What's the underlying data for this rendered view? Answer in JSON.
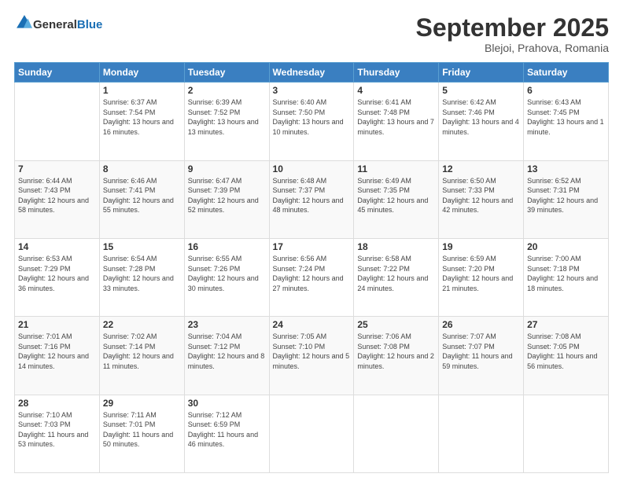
{
  "header": {
    "logo_general": "General",
    "logo_blue": "Blue",
    "title": "September 2025",
    "location": "Blejoi, Prahova, Romania"
  },
  "weekdays": [
    "Sunday",
    "Monday",
    "Tuesday",
    "Wednesday",
    "Thursday",
    "Friday",
    "Saturday"
  ],
  "weeks": [
    [
      {
        "day": "",
        "sunrise": "",
        "sunset": "",
        "daylight": ""
      },
      {
        "day": "1",
        "sunrise": "Sunrise: 6:37 AM",
        "sunset": "Sunset: 7:54 PM",
        "daylight": "Daylight: 13 hours and 16 minutes."
      },
      {
        "day": "2",
        "sunrise": "Sunrise: 6:39 AM",
        "sunset": "Sunset: 7:52 PM",
        "daylight": "Daylight: 13 hours and 13 minutes."
      },
      {
        "day": "3",
        "sunrise": "Sunrise: 6:40 AM",
        "sunset": "Sunset: 7:50 PM",
        "daylight": "Daylight: 13 hours and 10 minutes."
      },
      {
        "day": "4",
        "sunrise": "Sunrise: 6:41 AM",
        "sunset": "Sunset: 7:48 PM",
        "daylight": "Daylight: 13 hours and 7 minutes."
      },
      {
        "day": "5",
        "sunrise": "Sunrise: 6:42 AM",
        "sunset": "Sunset: 7:46 PM",
        "daylight": "Daylight: 13 hours and 4 minutes."
      },
      {
        "day": "6",
        "sunrise": "Sunrise: 6:43 AM",
        "sunset": "Sunset: 7:45 PM",
        "daylight": "Daylight: 13 hours and 1 minute."
      }
    ],
    [
      {
        "day": "7",
        "sunrise": "Sunrise: 6:44 AM",
        "sunset": "Sunset: 7:43 PM",
        "daylight": "Daylight: 12 hours and 58 minutes."
      },
      {
        "day": "8",
        "sunrise": "Sunrise: 6:46 AM",
        "sunset": "Sunset: 7:41 PM",
        "daylight": "Daylight: 12 hours and 55 minutes."
      },
      {
        "day": "9",
        "sunrise": "Sunrise: 6:47 AM",
        "sunset": "Sunset: 7:39 PM",
        "daylight": "Daylight: 12 hours and 52 minutes."
      },
      {
        "day": "10",
        "sunrise": "Sunrise: 6:48 AM",
        "sunset": "Sunset: 7:37 PM",
        "daylight": "Daylight: 12 hours and 48 minutes."
      },
      {
        "day": "11",
        "sunrise": "Sunrise: 6:49 AM",
        "sunset": "Sunset: 7:35 PM",
        "daylight": "Daylight: 12 hours and 45 minutes."
      },
      {
        "day": "12",
        "sunrise": "Sunrise: 6:50 AM",
        "sunset": "Sunset: 7:33 PM",
        "daylight": "Daylight: 12 hours and 42 minutes."
      },
      {
        "day": "13",
        "sunrise": "Sunrise: 6:52 AM",
        "sunset": "Sunset: 7:31 PM",
        "daylight": "Daylight: 12 hours and 39 minutes."
      }
    ],
    [
      {
        "day": "14",
        "sunrise": "Sunrise: 6:53 AM",
        "sunset": "Sunset: 7:29 PM",
        "daylight": "Daylight: 12 hours and 36 minutes."
      },
      {
        "day": "15",
        "sunrise": "Sunrise: 6:54 AM",
        "sunset": "Sunset: 7:28 PM",
        "daylight": "Daylight: 12 hours and 33 minutes."
      },
      {
        "day": "16",
        "sunrise": "Sunrise: 6:55 AM",
        "sunset": "Sunset: 7:26 PM",
        "daylight": "Daylight: 12 hours and 30 minutes."
      },
      {
        "day": "17",
        "sunrise": "Sunrise: 6:56 AM",
        "sunset": "Sunset: 7:24 PM",
        "daylight": "Daylight: 12 hours and 27 minutes."
      },
      {
        "day": "18",
        "sunrise": "Sunrise: 6:58 AM",
        "sunset": "Sunset: 7:22 PM",
        "daylight": "Daylight: 12 hours and 24 minutes."
      },
      {
        "day": "19",
        "sunrise": "Sunrise: 6:59 AM",
        "sunset": "Sunset: 7:20 PM",
        "daylight": "Daylight: 12 hours and 21 minutes."
      },
      {
        "day": "20",
        "sunrise": "Sunrise: 7:00 AM",
        "sunset": "Sunset: 7:18 PM",
        "daylight": "Daylight: 12 hours and 18 minutes."
      }
    ],
    [
      {
        "day": "21",
        "sunrise": "Sunrise: 7:01 AM",
        "sunset": "Sunset: 7:16 PM",
        "daylight": "Daylight: 12 hours and 14 minutes."
      },
      {
        "day": "22",
        "sunrise": "Sunrise: 7:02 AM",
        "sunset": "Sunset: 7:14 PM",
        "daylight": "Daylight: 12 hours and 11 minutes."
      },
      {
        "day": "23",
        "sunrise": "Sunrise: 7:04 AM",
        "sunset": "Sunset: 7:12 PM",
        "daylight": "Daylight: 12 hours and 8 minutes."
      },
      {
        "day": "24",
        "sunrise": "Sunrise: 7:05 AM",
        "sunset": "Sunset: 7:10 PM",
        "daylight": "Daylight: 12 hours and 5 minutes."
      },
      {
        "day": "25",
        "sunrise": "Sunrise: 7:06 AM",
        "sunset": "Sunset: 7:08 PM",
        "daylight": "Daylight: 12 hours and 2 minutes."
      },
      {
        "day": "26",
        "sunrise": "Sunrise: 7:07 AM",
        "sunset": "Sunset: 7:07 PM",
        "daylight": "Daylight: 11 hours and 59 minutes."
      },
      {
        "day": "27",
        "sunrise": "Sunrise: 7:08 AM",
        "sunset": "Sunset: 7:05 PM",
        "daylight": "Daylight: 11 hours and 56 minutes."
      }
    ],
    [
      {
        "day": "28",
        "sunrise": "Sunrise: 7:10 AM",
        "sunset": "Sunset: 7:03 PM",
        "daylight": "Daylight: 11 hours and 53 minutes."
      },
      {
        "day": "29",
        "sunrise": "Sunrise: 7:11 AM",
        "sunset": "Sunset: 7:01 PM",
        "daylight": "Daylight: 11 hours and 50 minutes."
      },
      {
        "day": "30",
        "sunrise": "Sunrise: 7:12 AM",
        "sunset": "Sunset: 6:59 PM",
        "daylight": "Daylight: 11 hours and 46 minutes."
      },
      {
        "day": "",
        "sunrise": "",
        "sunset": "",
        "daylight": ""
      },
      {
        "day": "",
        "sunrise": "",
        "sunset": "",
        "daylight": ""
      },
      {
        "day": "",
        "sunrise": "",
        "sunset": "",
        "daylight": ""
      },
      {
        "day": "",
        "sunrise": "",
        "sunset": "",
        "daylight": ""
      }
    ]
  ]
}
